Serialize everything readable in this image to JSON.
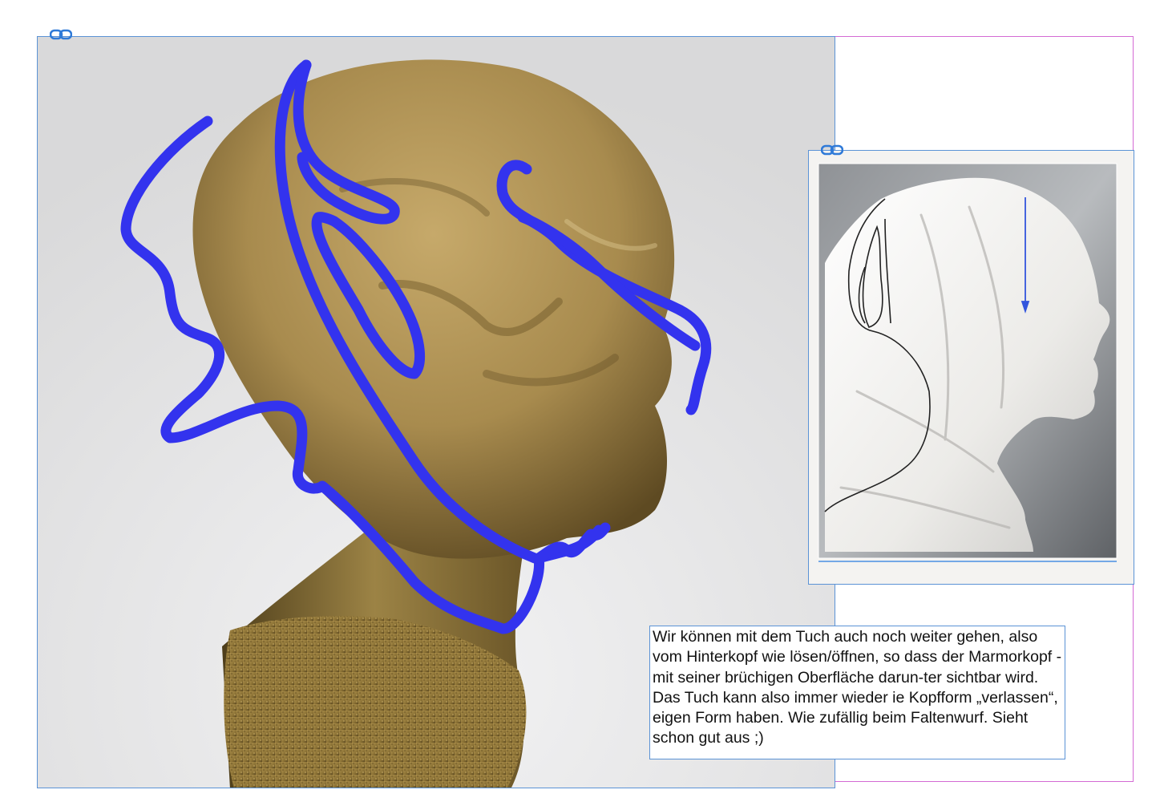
{
  "canvas": {
    "guide_color": "#d46ad4",
    "frame_color": "#5b93d6",
    "link_icon": "chain-link-icon"
  },
  "images": {
    "main": {
      "icon": "bust-photo-icon",
      "background": "#dcdcdd",
      "sculpture_color": "#a58a4c",
      "annotation_color": "#3333ee"
    },
    "side": {
      "icon": "draped-head-photo-icon",
      "background": "#f4f3f1",
      "arrow_color": "#3355dd"
    }
  },
  "note": {
    "text": "Wir können mit dem Tuch auch noch weiter gehen, also vom Hinterkopf wie lösen/öffnen, so dass der Marmorkopf  - mit seiner brüchigen Oberfläche darun-ter sichtbar wird. Das Tuch kann also immer wieder ie Kopfform „verlassen“, eigen Form haben. Wie zufällig beim Faltenwurf. Sieht schon gut aus ;)"
  }
}
